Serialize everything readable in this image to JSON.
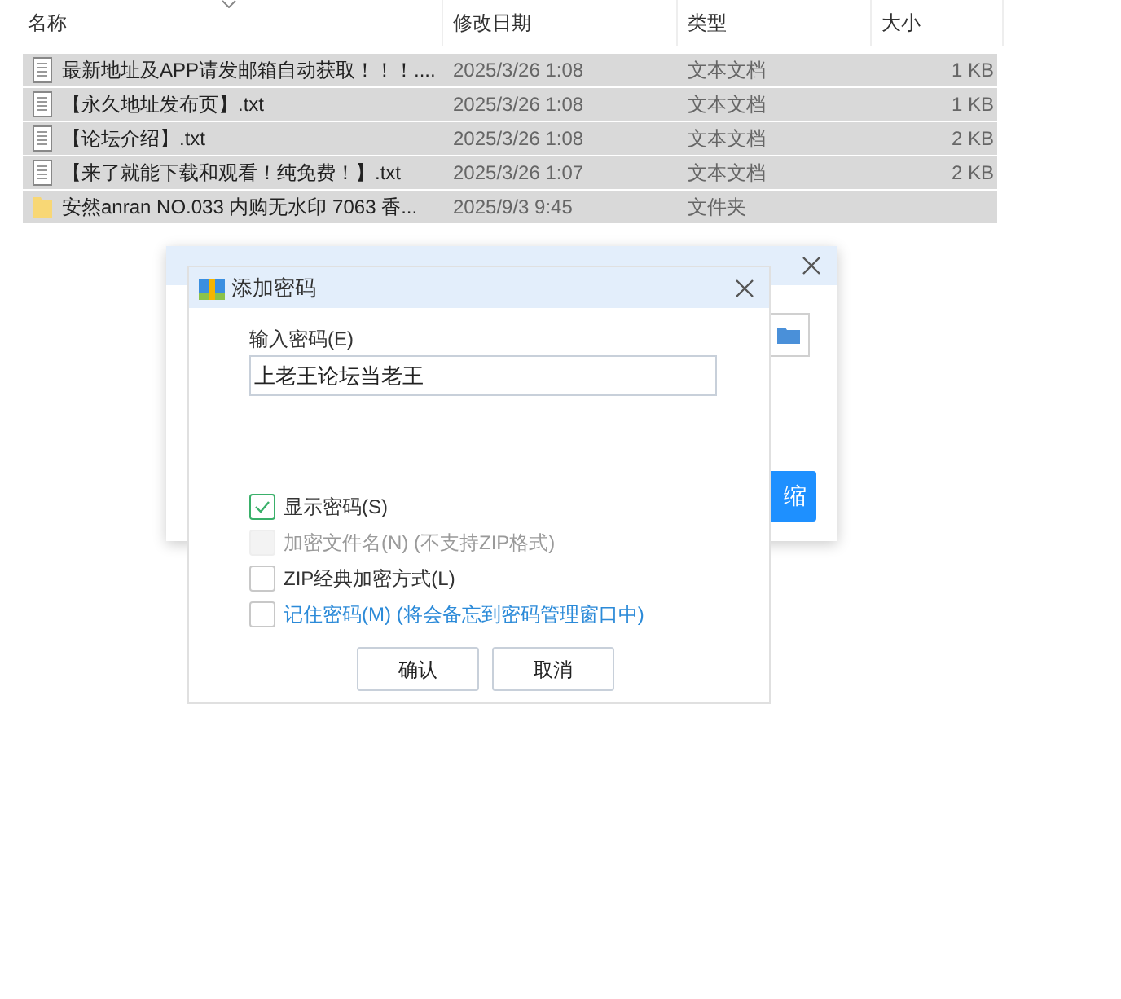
{
  "columns": [
    {
      "label": "名称",
      "sorted": true
    },
    {
      "label": "修改日期",
      "sorted": false
    },
    {
      "label": "类型",
      "sorted": false
    },
    {
      "label": "大小",
      "sorted": false
    }
  ],
  "files": [
    {
      "kind": "text",
      "name": "最新地址及APP请发邮箱自动获取！！！....",
      "date": "2025/3/26 1:08",
      "type": "文本文档",
      "size": "1 KB",
      "selected": true
    },
    {
      "kind": "text",
      "name": "【永久地址发布页】.txt",
      "date": "2025/3/26 1:08",
      "type": "文本文档",
      "size": "1 KB",
      "selected": true
    },
    {
      "kind": "text",
      "name": "【论坛介绍】.txt",
      "date": "2025/3/26 1:08",
      "type": "文本文档",
      "size": "2 KB",
      "selected": true
    },
    {
      "kind": "text",
      "name": "【来了就能下载和观看！纯免费！】.txt",
      "date": "2025/3/26 1:07",
      "type": "文本文档",
      "size": "2 KB",
      "selected": true
    },
    {
      "kind": "folder",
      "name": "安然anran NO.033 内购无水印 7063 香...",
      "date": "2025/9/3 9:45",
      "type": "文件夹",
      "selected": true
    }
  ],
  "back_dialog": {
    "button_label": "缩"
  },
  "dialog": {
    "title": "添加密码",
    "field_label": "输入密码(E)",
    "password": "上老王论坛当老王",
    "options": [
      {
        "label": "显示密码(S)",
        "checked": true,
        "disabled": false,
        "link": false
      },
      {
        "label": "加密文件名(N) (不支持ZIP格式)",
        "checked": false,
        "disabled": true,
        "link": false
      },
      {
        "label": "ZIP经典加密方式(L)",
        "checked": false,
        "disabled": false,
        "link": false
      },
      {
        "label": "记住密码(M) (将会备忘到密码管理窗口中)",
        "checked": false,
        "disabled": false,
        "link": true
      }
    ],
    "buttons": [
      "确认",
      "取消"
    ]
  }
}
